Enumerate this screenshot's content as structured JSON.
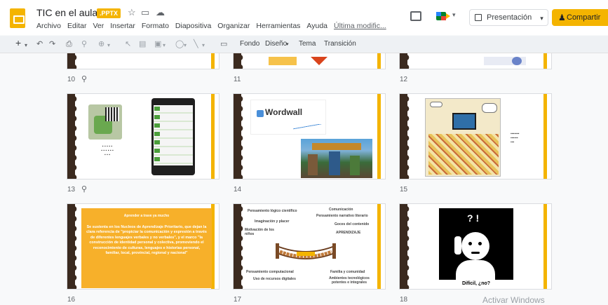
{
  "header": {
    "title": "TIC en el aula",
    "badge": ".PPTX",
    "menu": [
      "Archivo",
      "Editar",
      "Ver",
      "Insertar",
      "Formato",
      "Diapositiva",
      "Organizar",
      "Herramientas",
      "Ayuda"
    ],
    "last_edit": "Última modific...",
    "present_label": "Presentación",
    "share_label": "Compartir"
  },
  "toolbar": {
    "fondo": "Fondo",
    "diseno": "Diseño",
    "tema": "Tema",
    "transicion": "Transición"
  },
  "slides": {
    "s10": "10",
    "s11": "11",
    "s12": "12",
    "s13": "13",
    "s14": "14",
    "s15": "15",
    "s16": "16",
    "s17": "17",
    "s18": "18"
  },
  "slide14": {
    "logo": "Wordwall"
  },
  "slide16": {
    "heading": "Aprender a trave ya mucho",
    "body": "Se sustenta en los Nucleos de Aprendizaje Prioritario, que dejan la clara referencia de \"propiciar la comunicación y expresión a través de diferentes lenguajes verbales y no verbales\", y el marco \"la construcción de identidad personal y colectiva, promoviendo el reconocimiento de culturas, lenguajes e historias personal, familiar, local, provincial, regional y nacional\""
  },
  "slide17": {
    "l1": "Pensamiento lógico científico",
    "l2": "Comunicación",
    "l3": "Pensamiento narrativo literario",
    "l4": "Imaginación y placer",
    "l5": "Goces del contenido",
    "l6": "Motivación de los niños",
    "l7": "APRENDIZAJE",
    "l8": "Pensamiento computacional",
    "l9": "Familia y comunidad",
    "l10": "Uso de recursos digitales",
    "l11": "Ambientes tecnológicos potentes e integrales"
  },
  "slide18": {
    "marks": "? !",
    "caption": "Difícil, ¿no?"
  },
  "watermark": "Activar Windows",
  "colors": {
    "accent": "#f4b400",
    "frame": "#3b2a1f"
  }
}
